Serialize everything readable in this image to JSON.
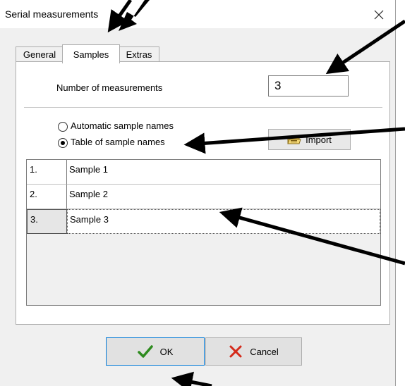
{
  "window": {
    "title": "Serial measurements",
    "close_glyph": "×"
  },
  "tabs": [
    {
      "label": "General",
      "active": false
    },
    {
      "label": "Samples",
      "active": true
    },
    {
      "label": "Extras",
      "active": false
    }
  ],
  "measurements": {
    "label": "Number of measurements",
    "value": "3"
  },
  "naming": {
    "automatic_label": "Automatic sample names",
    "table_label": "Table of sample names",
    "selected": "table"
  },
  "import_button": {
    "label": "Import",
    "icon": "folder-open-icon"
  },
  "samples_table": {
    "rows": [
      {
        "index": "1.",
        "name": "Sample 1"
      },
      {
        "index": "2.",
        "name": "Sample 2"
      },
      {
        "index": "3.",
        "name": "Sample 3"
      }
    ],
    "selected_row": 3
  },
  "buttons": {
    "ok": {
      "label": "OK",
      "icon": "checkmark-icon",
      "icon_color": "#2e8b1f"
    },
    "cancel": {
      "label": "Cancel",
      "icon": "x-mark-icon",
      "icon_color": "#d42a1a"
    }
  },
  "annotation_color": "#000000"
}
